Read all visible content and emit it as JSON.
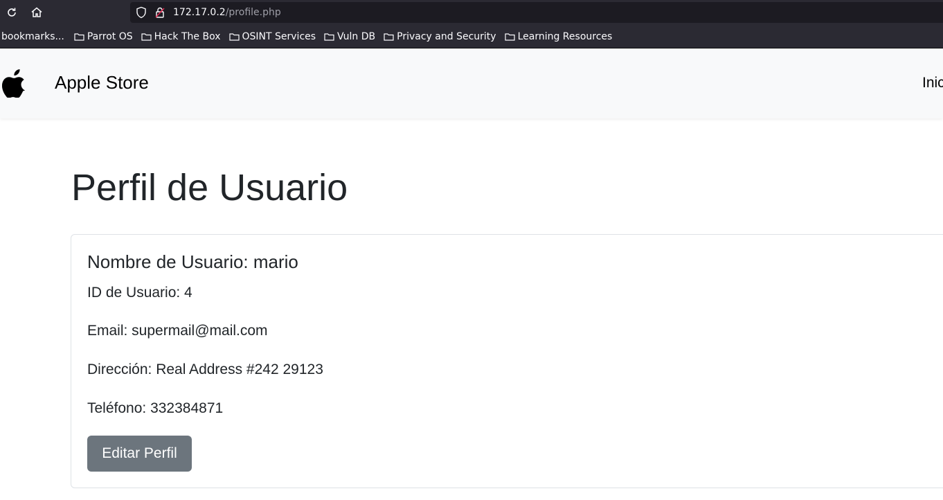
{
  "browser": {
    "url_host": "172.17.0.2",
    "url_path": "/profile.php",
    "bookmarks": [
      {
        "label": "bookmarks..."
      },
      {
        "label": "Parrot OS"
      },
      {
        "label": "Hack The Box"
      },
      {
        "label": "OSINT Services"
      },
      {
        "label": "Vuln DB"
      },
      {
        "label": "Privacy and Security"
      },
      {
        "label": "Learning Resources"
      }
    ],
    "icons": {
      "reload": "reload-icon",
      "home": "home-icon",
      "shield": "shield-icon",
      "lock": "insecure-lock-icon",
      "folder": "folder-icon"
    }
  },
  "navbar": {
    "brand": "Apple Store",
    "link_inicio": "Inic",
    "logo": "apple-logo-icon"
  },
  "profile": {
    "title": "Perfil de Usuario",
    "username": "Nombre de Usuario: mario",
    "user_id": "ID de Usuario: 4",
    "email": "Email: supermail@mail.com",
    "address": "Dirección: Real Address #242 29123",
    "phone": "Teléfono: 332384871",
    "edit_button": "Editar Perfil"
  },
  "colors": {
    "chrome_bg": "#2b2a33",
    "urlbar_bg": "#1c1b22",
    "navbar_bg": "#f8f9fa",
    "text": "#212529",
    "button_bg": "#6c757d",
    "card_border": "#dee2e6"
  }
}
